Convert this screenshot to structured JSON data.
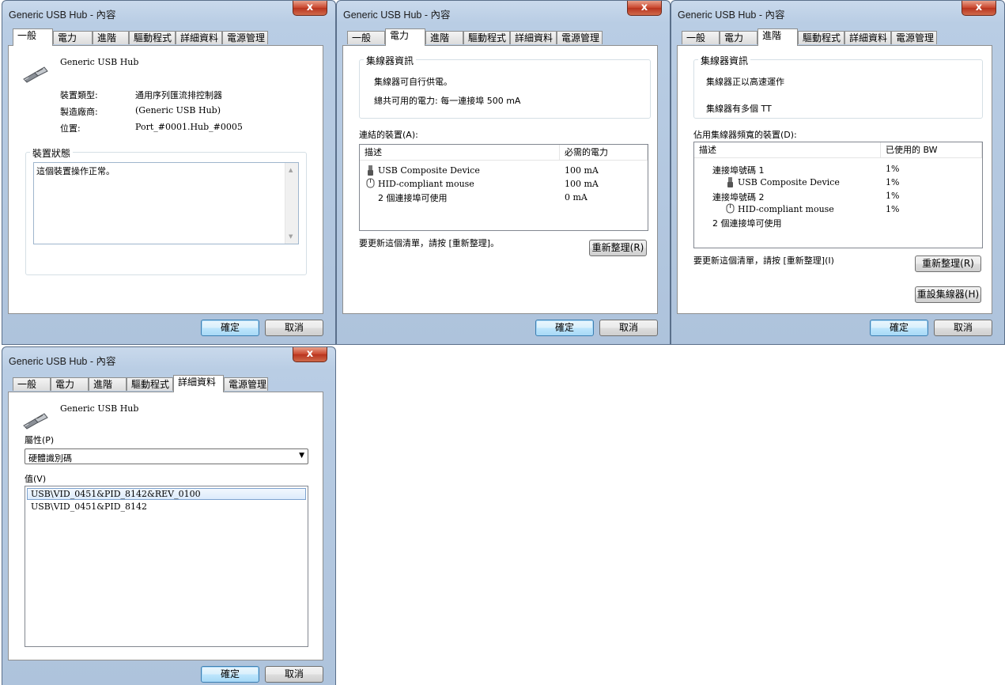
{
  "common": {
    "window_title": "Generic USB Hub - 內容",
    "close_label": "x",
    "ok_label": "確定",
    "cancel_label": "取消",
    "tabs": [
      "一般",
      "電力",
      "進階",
      "驅動程式",
      "詳細資料",
      "電源管理"
    ]
  },
  "general": {
    "device_name": "Generic USB Hub",
    "type_label": "裝置類型:",
    "type_value": "通用序列匯流排控制器",
    "mfr_label": "製造廠商:",
    "mfr_value": "(Generic USB Hub)",
    "loc_label": "位置:",
    "loc_value": "Port_#0001.Hub_#0005",
    "status_legend": "裝置狀態",
    "status_text": "這個裝置操作正常。"
  },
  "power": {
    "hub_info_legend": "集線器資訊",
    "self_powered": "集線器可自行供電。",
    "total_power": "總共可用的電力: 每一連接埠 500 mA",
    "attached_label": "連結的裝置(A):",
    "col_desc": "描述",
    "col_power": "必需的電力",
    "rows": [
      {
        "desc": "USB Composite Device",
        "power": "100 mA"
      },
      {
        "desc": "HID-compliant mouse",
        "power": "100 mA"
      },
      {
        "desc": "2 個連接埠可使用",
        "power": "0 mA"
      }
    ],
    "refresh_hint": "要更新這個清單，請按 [重新整理]。",
    "refresh_btn": "重新整理(R)"
  },
  "advanced": {
    "hub_info_legend": "集線器資訊",
    "speed": "集線器正以高速運作",
    "tt": "集線器有多個 TT",
    "bw_label": "佔用集線器頻寬的裝置(D):",
    "col_desc": "描述",
    "col_bw": "已使用的 BW",
    "rows": [
      {
        "desc": "連接埠號碼 1",
        "bw": "1%"
      },
      {
        "desc": "USB Composite Device",
        "bw": "1%"
      },
      {
        "desc": "連接埠號碼 2",
        "bw": "1%"
      },
      {
        "desc": "HID-compliant mouse",
        "bw": "1%"
      },
      {
        "desc": "2 個連接埠可使用",
        "bw": ""
      }
    ],
    "refresh_hint": "要更新這個清單，請按 [重新整理](I)",
    "refresh_btn": "重新整理(R)",
    "reset_btn": "重設集線器(H)"
  },
  "details": {
    "device_name": "Generic USB Hub",
    "property_label": "屬性(P)",
    "property_value": "硬體識別碼",
    "value_label": "值(V)",
    "values": [
      "USB\\VID_0451&PID_8142&REV_0100",
      "USB\\VID_0451&PID_8142"
    ]
  }
}
